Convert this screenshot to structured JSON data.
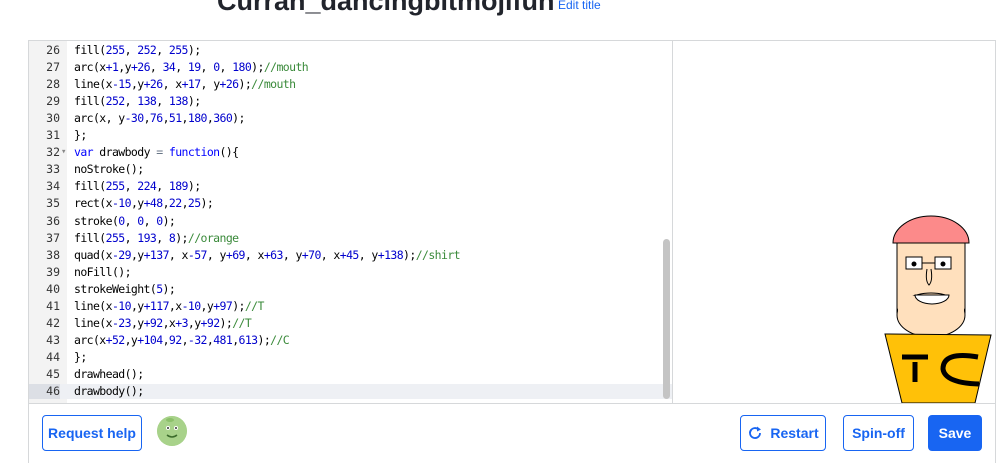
{
  "page": {
    "title": "Curran_dancingbitmojifun",
    "edit_title_label": "Edit title"
  },
  "editor": {
    "lines": [
      {
        "n": "26",
        "code": "fill(255, 252, 255);"
      },
      {
        "n": "27",
        "code": "arc(x+1,y+26, 34, 19, 0, 180);//mouth"
      },
      {
        "n": "28",
        "code": "line(x-15,y+26, x+17, y+26);//mouth"
      },
      {
        "n": "29",
        "code": "fill(252, 138, 138);"
      },
      {
        "n": "30",
        "code": "arc(x, y-30,76,51,180,360);"
      },
      {
        "n": "31",
        "code": "};"
      },
      {
        "n": "32",
        "code": "var drawbody = function(){"
      },
      {
        "n": "33",
        "code": "noStroke();"
      },
      {
        "n": "34",
        "code": "fill(255, 224, 189);"
      },
      {
        "n": "35",
        "code": "rect(x-10,y+48,22,25);"
      },
      {
        "n": "36",
        "code": "stroke(0, 0, 0);"
      },
      {
        "n": "37",
        "code": "fill(255, 193, 8);//orange"
      },
      {
        "n": "38",
        "code": "quad(x-29,y+137, x-57, y+69, x+63, y+70, x+45, y+138);//shirt"
      },
      {
        "n": "39",
        "code": "noFill();"
      },
      {
        "n": "40",
        "code": "strokeWeight(5);"
      },
      {
        "n": "41",
        "code": "line(x-10,y+117,x-10,y+97);//T"
      },
      {
        "n": "42",
        "code": "line(x-23,y+92,x+3,y+92);//T"
      },
      {
        "n": "43",
        "code": "arc(x+52,y+104,92,-32,481,613);//C"
      },
      {
        "n": "44",
        "code": "};"
      },
      {
        "n": "45",
        "code": "drawhead();"
      },
      {
        "n": "46",
        "code": "drawbody();"
      }
    ],
    "active_line": "46",
    "fold_line": "32"
  },
  "canvas": {
    "shirt_text": "TC",
    "colors": {
      "skin": "#ffe0bd",
      "hat": "#fc8a8a",
      "shirt": "#ffc108"
    }
  },
  "toolbar": {
    "request_help_label": "Request help",
    "restart_label": "Restart",
    "spinoff_label": "Spin-off",
    "save_label": "Save",
    "restart_icon": "refresh-icon"
  },
  "colors": {
    "accent": "#1865f2",
    "border": "#d6d8da"
  }
}
